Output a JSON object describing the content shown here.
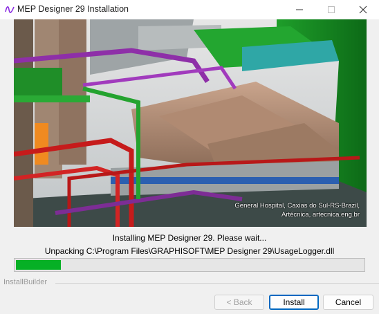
{
  "window": {
    "title": "MEP Designer 29 Installation",
    "app_icon": "wave-logo-icon",
    "controls": [
      "minimize-icon",
      "maximize-icon",
      "close-icon"
    ]
  },
  "banner": {
    "caption_line1": "General Hospital, Caxias do Sul-RS-Brazil,",
    "caption_line2": "Artécnica, artecnica.eng.br"
  },
  "status": {
    "main": "Installing MEP Designer 29. Please wait...",
    "file": "Unpacking C:\\Program Files\\GRAPHISOFT\\MEP Designer 29\\UsageLogger.dll"
  },
  "progress": {
    "fraction": 0.13,
    "color": "#06b025"
  },
  "footer": {
    "brand": "InstallBuilder",
    "back_label": "< Back",
    "install_label": "Install",
    "cancel_label": "Cancel"
  },
  "colors": {
    "accent": "#0067c0",
    "progress": "#06b025"
  }
}
